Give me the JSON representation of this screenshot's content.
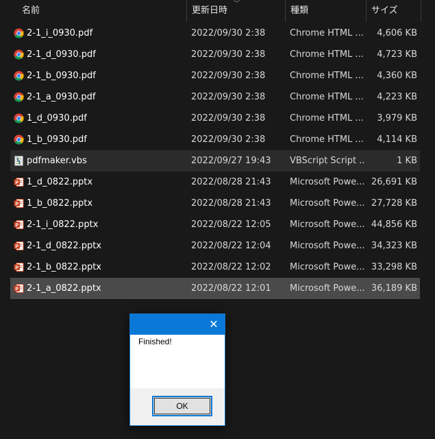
{
  "columns": {
    "name": "名前",
    "date": "更新日時",
    "type": "種類",
    "size": "サイズ"
  },
  "files": [
    {
      "name": "2-1_i_0930.pdf",
      "date": "2022/09/30 2:38",
      "type": "Chrome HTML ...",
      "size": "4,606 KB",
      "icon": "chrome-icon"
    },
    {
      "name": "2-1_d_0930.pdf",
      "date": "2022/09/30 2:38",
      "type": "Chrome HTML ...",
      "size": "4,723 KB",
      "icon": "chrome-icon"
    },
    {
      "name": "2-1_b_0930.pdf",
      "date": "2022/09/30 2:38",
      "type": "Chrome HTML ...",
      "size": "4,360 KB",
      "icon": "chrome-icon"
    },
    {
      "name": "2-1_a_0930.pdf",
      "date": "2022/09/30 2:38",
      "type": "Chrome HTML ...",
      "size": "4,223 KB",
      "icon": "chrome-icon"
    },
    {
      "name": "1_d_0930.pdf",
      "date": "2022/09/30 2:38",
      "type": "Chrome HTML ...",
      "size": "3,979 KB",
      "icon": "chrome-icon"
    },
    {
      "name": "1_b_0930.pdf",
      "date": "2022/09/30 2:38",
      "type": "Chrome HTML ...",
      "size": "4,114 KB",
      "icon": "chrome-icon"
    },
    {
      "name": "pdfmaker.vbs",
      "date": "2022/09/27 19:43",
      "type": "VBScript Script ...",
      "size": "1 KB",
      "icon": "vbscript-icon"
    },
    {
      "name": "1_d_0822.pptx",
      "date": "2022/08/28 21:43",
      "type": "Microsoft Powe...",
      "size": "26,691 KB",
      "icon": "powerpoint-icon"
    },
    {
      "name": "1_b_0822.pptx",
      "date": "2022/08/28 21:43",
      "type": "Microsoft Powe...",
      "size": "27,728 KB",
      "icon": "powerpoint-icon"
    },
    {
      "name": "2-1_i_0822.pptx",
      "date": "2022/08/22 12:05",
      "type": "Microsoft Powe...",
      "size": "44,856 KB",
      "icon": "powerpoint-icon"
    },
    {
      "name": "2-1_d_0822.pptx",
      "date": "2022/08/22 12:04",
      "type": "Microsoft Powe...",
      "size": "34,323 KB",
      "icon": "powerpoint-icon"
    },
    {
      "name": "2-1_b_0822.pptx",
      "date": "2022/08/22 12:02",
      "type": "Microsoft Powe...",
      "size": "33,298 KB",
      "icon": "powerpoint-icon"
    },
    {
      "name": "2-1_a_0822.pptx",
      "date": "2022/08/22 12:01",
      "type": "Microsoft Powe...",
      "size": "36,189 KB",
      "icon": "powerpoint-icon"
    }
  ],
  "hover_row": 6,
  "selected_row": 12,
  "dialog": {
    "close_glyph": "✕",
    "message": "Finished!",
    "ok_label": "OK"
  },
  "colors": {
    "background": "#191919",
    "selection": "#4a4a4a",
    "hover": "#2b2b2b",
    "dialog_accent": "#0a78d7"
  }
}
